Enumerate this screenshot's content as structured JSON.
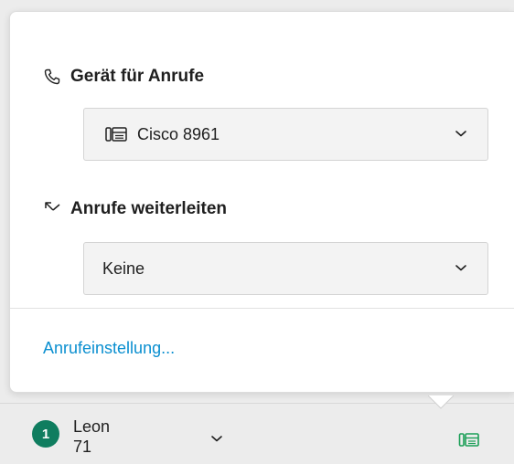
{
  "device_section": {
    "title": "Gerät für Anrufe",
    "icon": "phone-handset-icon",
    "selected": "Cisco 8961",
    "selected_icon": "desk-phone-icon"
  },
  "forward_section": {
    "title": "Anrufe weiterleiten",
    "icon": "call-forward-icon",
    "selected": "Keine"
  },
  "settings_link": "Anrufeinstellung...",
  "bottombar": {
    "badge_count": "1",
    "user_first_line": "Leon",
    "user_second_line": "71",
    "status_icon": "desk-phone-icon"
  },
  "colors": {
    "link": "#0a8fd0",
    "badge": "#0f7d5f",
    "status_icon": "#1a9e56"
  }
}
